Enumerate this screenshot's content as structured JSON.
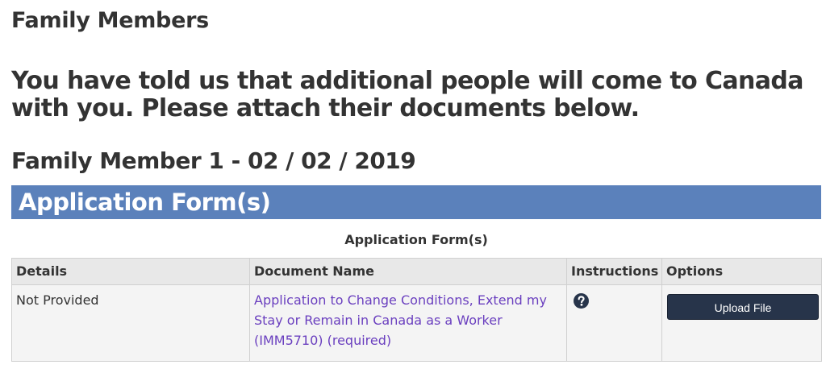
{
  "page": {
    "section_title": "Family Members",
    "intro_text": "You have told us that additional people will come to Canada with you. Please attach their documents below.",
    "member_heading": "Family Member 1 - 02 / 02 / 2019"
  },
  "application_forms": {
    "banner_title": "Application Form(s)",
    "table_caption": "Application Form(s)",
    "columns": [
      "Details",
      "Document Name",
      "Instructions",
      "Options"
    ],
    "rows": [
      {
        "details": "Not Provided",
        "document_name": "Application to Change Conditions, Extend my Stay or Remain in Canada as a Worker (IMM5710)  (required)",
        "instructions_icon": "question-circle-icon",
        "option_label": "Upload File"
      }
    ]
  },
  "colors": {
    "banner_bg": "#5b81bb",
    "link": "#6a3fbf",
    "button_bg": "#27344a",
    "header_bg": "#e8e8e8",
    "cell_bg": "#f4f4f4"
  }
}
